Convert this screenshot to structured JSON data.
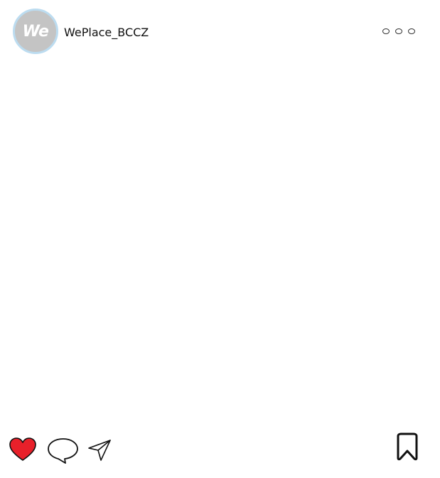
{
  "post": {
    "account": {
      "avatar_text": "We",
      "username": "WePlace_BCCZ"
    },
    "menu_icon": "more-options-icon",
    "actions": {
      "like": {
        "icon": "heart-icon",
        "liked": true,
        "color": "#e8202a"
      },
      "comment": {
        "icon": "comment-bubble-icon"
      },
      "share": {
        "icon": "paper-plane-icon"
      },
      "save": {
        "icon": "bookmark-icon"
      }
    },
    "colors": {
      "avatar_bg": "#c4c4c4",
      "avatar_ring": "#bcdcf0",
      "like_red": "#e8202a"
    }
  }
}
